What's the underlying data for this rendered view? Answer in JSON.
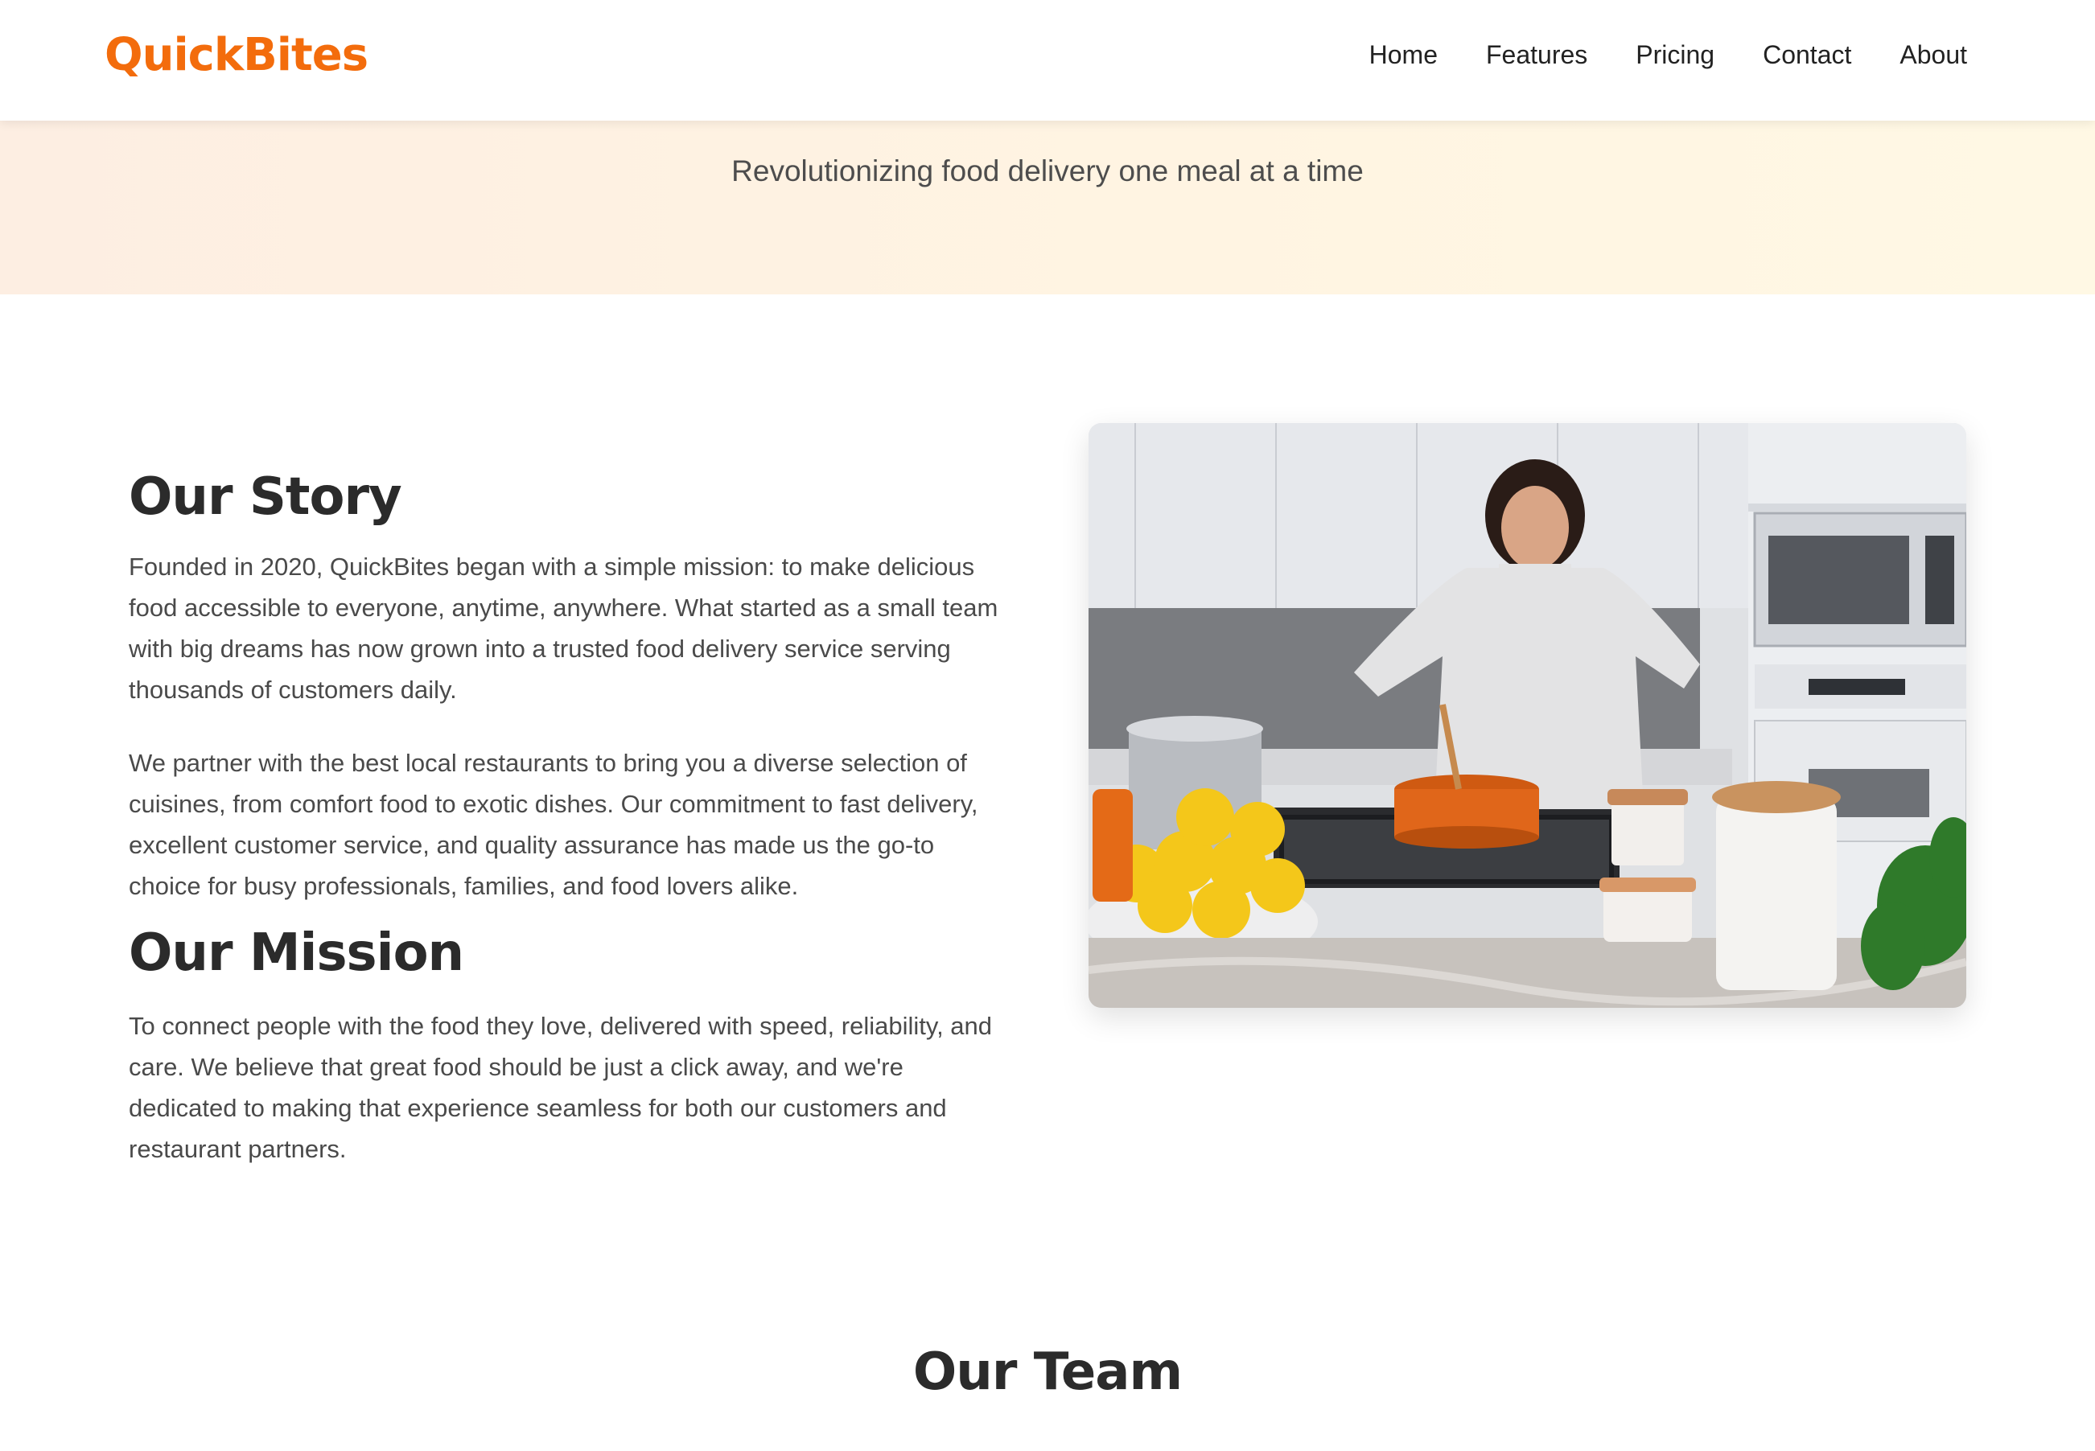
{
  "brand": {
    "name": "QuickBites",
    "color": "#f36c0c"
  },
  "nav": {
    "items": [
      {
        "label": "Home"
      },
      {
        "label": "Features"
      },
      {
        "label": "Pricing"
      },
      {
        "label": "Contact"
      },
      {
        "label": "About"
      }
    ]
  },
  "hero": {
    "tagline": "Revolutionizing food delivery one meal at a time"
  },
  "story": {
    "heading": "Our Story",
    "paragraphs": [
      "Founded in 2020, QuickBites began with a simple mission: to make delicious food accessible to everyone, anytime, anywhere. What started as a small team with big dreams has now grown into a trusted food delivery service serving thousands of customers daily.",
      "We partner with the best local restaurants to bring you a diverse selection of cuisines, from comfort food to exotic dishes. Our commitment to fast delivery, excellent customer service, and quality assurance has made us the go-to choice for busy professionals, families, and food lovers alike."
    ]
  },
  "mission": {
    "heading": "Our Mission",
    "paragraph": "To connect people with the food they love, delivered with speed, reliability, and care. We believe that great food should be just a click away, and we're dedicated to making that experience seamless for both our customers and restaurant partners."
  },
  "team": {
    "heading": "Our Team"
  },
  "colors": {
    "accent": "#f36c0c",
    "heading": "#2b2b2b",
    "body_text": "#4a4a4a",
    "hero_gradient_start": "#fdeee2",
    "hero_gradient_end": "#fff8e4"
  }
}
